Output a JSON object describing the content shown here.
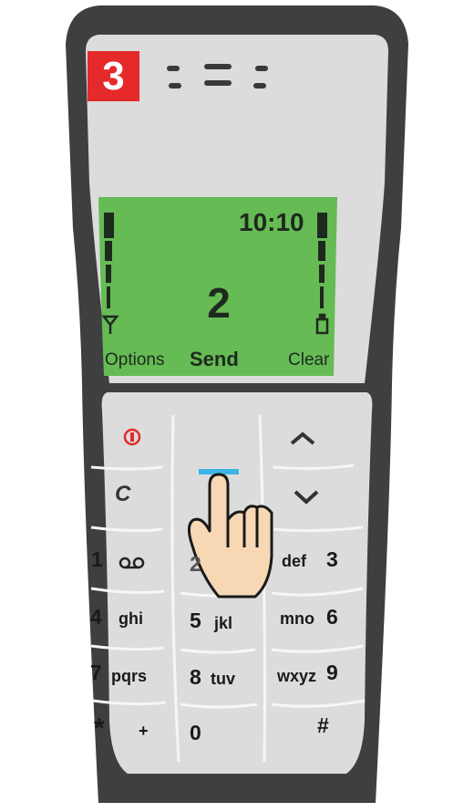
{
  "step": {
    "number": "3",
    "color": "#e42a2a"
  },
  "screen": {
    "clock": "10:10",
    "entered_digit": "2",
    "softkeys": {
      "left": "Options",
      "center": "Send",
      "right": "Clear"
    },
    "background": "#66bb55",
    "signal_icon": "antenna-icon",
    "battery_icon": "battery-icon"
  },
  "keys": {
    "end_icon": "power-icon",
    "clear_label": "C",
    "up_icon": "chevron-up-icon",
    "down_icon": "chevron-down-icon",
    "highlight_color": "#3cb4e6",
    "k1": {
      "num": "1",
      "letters": "oo"
    },
    "k2": {
      "num": "2",
      "letters": ""
    },
    "k3": {
      "num": "3",
      "letters": "def"
    },
    "k4": {
      "num": "4",
      "letters": "ghi"
    },
    "k5": {
      "num": "5",
      "letters": "jkl"
    },
    "k6": {
      "num": "6",
      "letters": "mno"
    },
    "k7": {
      "num": "7",
      "letters": "pqrs"
    },
    "k8": {
      "num": "8",
      "letters": "tuv"
    },
    "k9": {
      "num": "9",
      "letters": "wxyz"
    },
    "kstar": {
      "num": "*",
      "letters": "+"
    },
    "k0": {
      "num": "0",
      "letters": ""
    },
    "khash": {
      "num": "#",
      "letters": ""
    }
  },
  "pointer": {
    "icon": "hand-pointer-icon"
  }
}
